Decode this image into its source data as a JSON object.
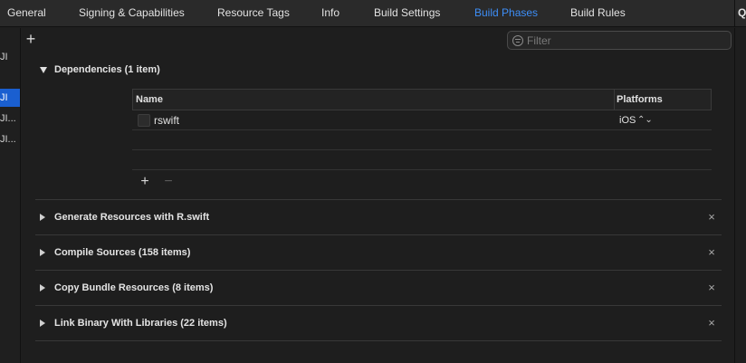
{
  "tabs": [
    {
      "label": "General"
    },
    {
      "label": "Signing & Capabilities"
    },
    {
      "label": "Resource Tags"
    },
    {
      "label": "Info"
    },
    {
      "label": "Build Settings"
    },
    {
      "label": "Build Phases",
      "active": true
    },
    {
      "label": "Build Rules"
    }
  ],
  "edge_label": "Q",
  "sidebar": {
    "items": [
      {
        "label": "JI"
      },
      {
        "label": "JI"
      },
      {
        "label": "JI..."
      },
      {
        "label": "JI..."
      }
    ]
  },
  "toolbar": {
    "add_label": "+",
    "filter_placeholder": "Filter"
  },
  "phases": [
    {
      "title": "Dependencies (1 item)",
      "expanded": true
    },
    {
      "title": "Generate Resources with R.swift",
      "expanded": false
    },
    {
      "title": "Compile Sources (158 items)",
      "expanded": false
    },
    {
      "title": "Copy Bundle Resources (8 items)",
      "expanded": false
    },
    {
      "title": "Link Binary With Libraries (22 items)",
      "expanded": false
    }
  ],
  "dependencies": {
    "columns": {
      "name": "Name",
      "platforms": "Platforms"
    },
    "rows": [
      {
        "name": "rswift",
        "platform": "iOS"
      }
    ],
    "add_label": "+",
    "remove_label": "−"
  },
  "icons": {
    "close": "×",
    "updown": "⌃⌄"
  },
  "colors": {
    "accent": "#3d8ef7",
    "selection": "#1a5fd0",
    "background": "#1e1e1e"
  }
}
